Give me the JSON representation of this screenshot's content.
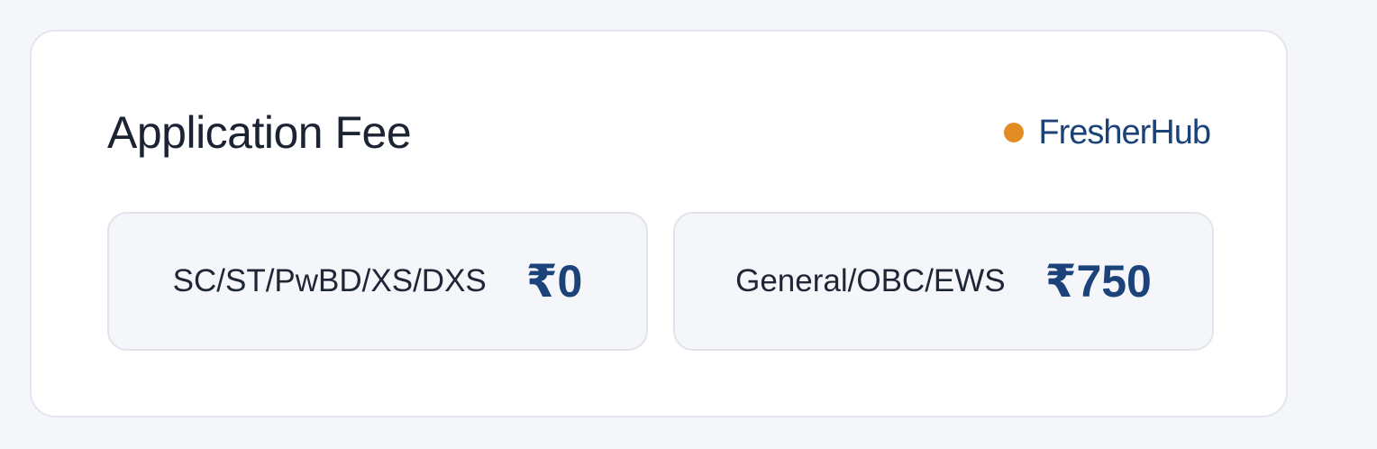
{
  "card": {
    "title": "Application Fee",
    "brand": {
      "name": "FresherHub",
      "dot_color": "#e38c24",
      "text_color": "#1b437a"
    },
    "fees": [
      {
        "category": "SC/ST/PwBD/XS/DXS",
        "amount": "₹0"
      },
      {
        "category": "General/OBC/EWS",
        "amount": "₹750"
      }
    ]
  }
}
